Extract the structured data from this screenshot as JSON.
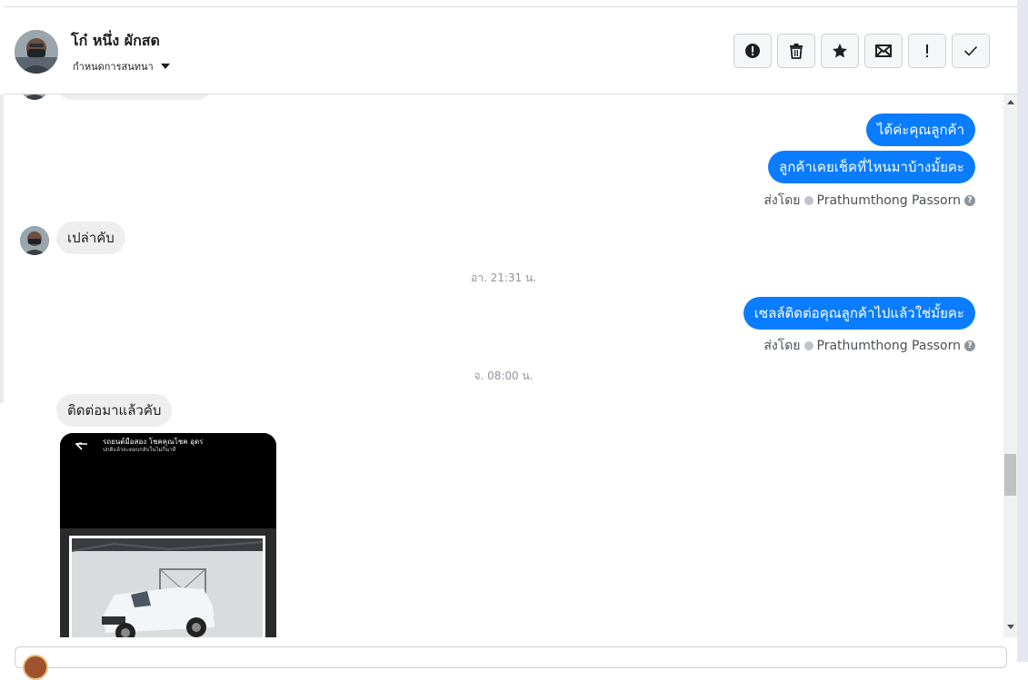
{
  "conversation": {
    "contact_name": "โก๋ หนึ่ง ผักสด",
    "assign_label": "กำหนดการสนทนา"
  },
  "toolbar": [
    {
      "name": "spam-button",
      "icon": "alert-circle-icon"
    },
    {
      "name": "delete-button",
      "icon": "trash-icon"
    },
    {
      "name": "star-button",
      "icon": "star-icon"
    },
    {
      "name": "mark-unread-button",
      "icon": "envelope-icon"
    },
    {
      "name": "follow-up-button",
      "icon": "exclamation-icon"
    },
    {
      "name": "mark-done-button",
      "icon": "checkmark-icon"
    }
  ],
  "thread": {
    "messages": [
      {
        "direction": "out",
        "text": "ได้ค่ะคุณลูกค้า"
      },
      {
        "direction": "out",
        "text": "ลูกค้าเคยเช็คที่ไหนมาบ้างมั้ยคะ"
      },
      {
        "direction": "in",
        "text": "เปล่าคับ"
      },
      {
        "direction": "out",
        "text": "เซลล์ติดต่อคุณลูกค้าไปแล้วใช่มั้ยคะ"
      },
      {
        "direction": "in",
        "text": "ติดต่อมาแล้วคับ"
      }
    ],
    "sent_by_prefix": "ส่งโดย",
    "sent_by_name": "Prathumthong Passorn",
    "help_glyph": "?",
    "timestamps": [
      "อา. 21:31 น.",
      "จ. 08:00 น."
    ],
    "photo": {
      "title": "รถยนต์มือสอง โชคคุณโชค อุดร",
      "subtitle": "ปกติแล้วจะตอบกลับในไม่กี่นาที"
    }
  },
  "colors": {
    "outgoing_bubble": "#0a7cff",
    "incoming_bubble": "#eeeeee",
    "header_border": "#dadde1"
  }
}
